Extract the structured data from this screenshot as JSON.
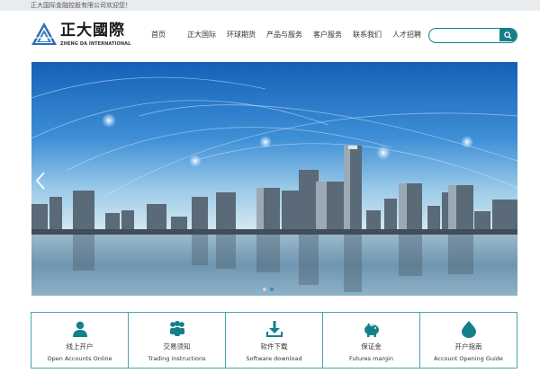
{
  "topbar": {
    "welcome": "正大国际金融控股有限公司欢迎您！"
  },
  "logo": {
    "cn": "正大國際",
    "en": "ZHENG DA INTERNATIONAL"
  },
  "nav": [
    {
      "label": "首页"
    },
    {
      "label": "正大国际"
    },
    {
      "label": "环球期货"
    },
    {
      "label": "产品与服务"
    },
    {
      "label": "客户服务"
    },
    {
      "label": "联系我们"
    },
    {
      "label": "人才招聘"
    }
  ],
  "search": {
    "placeholder": ""
  },
  "banner": {
    "slides": 2,
    "active_slide": 2
  },
  "services": [
    {
      "cn": "线上开户",
      "en": "Open Accounts Online",
      "icon": "person-icon"
    },
    {
      "cn": "交易须知",
      "en": "Trading instructions",
      "icon": "people-icon"
    },
    {
      "cn": "软件下载",
      "en": "Software download",
      "icon": "download-icon"
    },
    {
      "cn": "保证金",
      "en": "Futures margin",
      "icon": "piggy-bank-icon"
    },
    {
      "cn": "开户指南",
      "en": "Account Opening Guide",
      "icon": "flame-icon"
    }
  ],
  "colors": {
    "accent": "#13808a",
    "border": "#4aa4ac",
    "topbar_bg": "#e9ecef"
  }
}
